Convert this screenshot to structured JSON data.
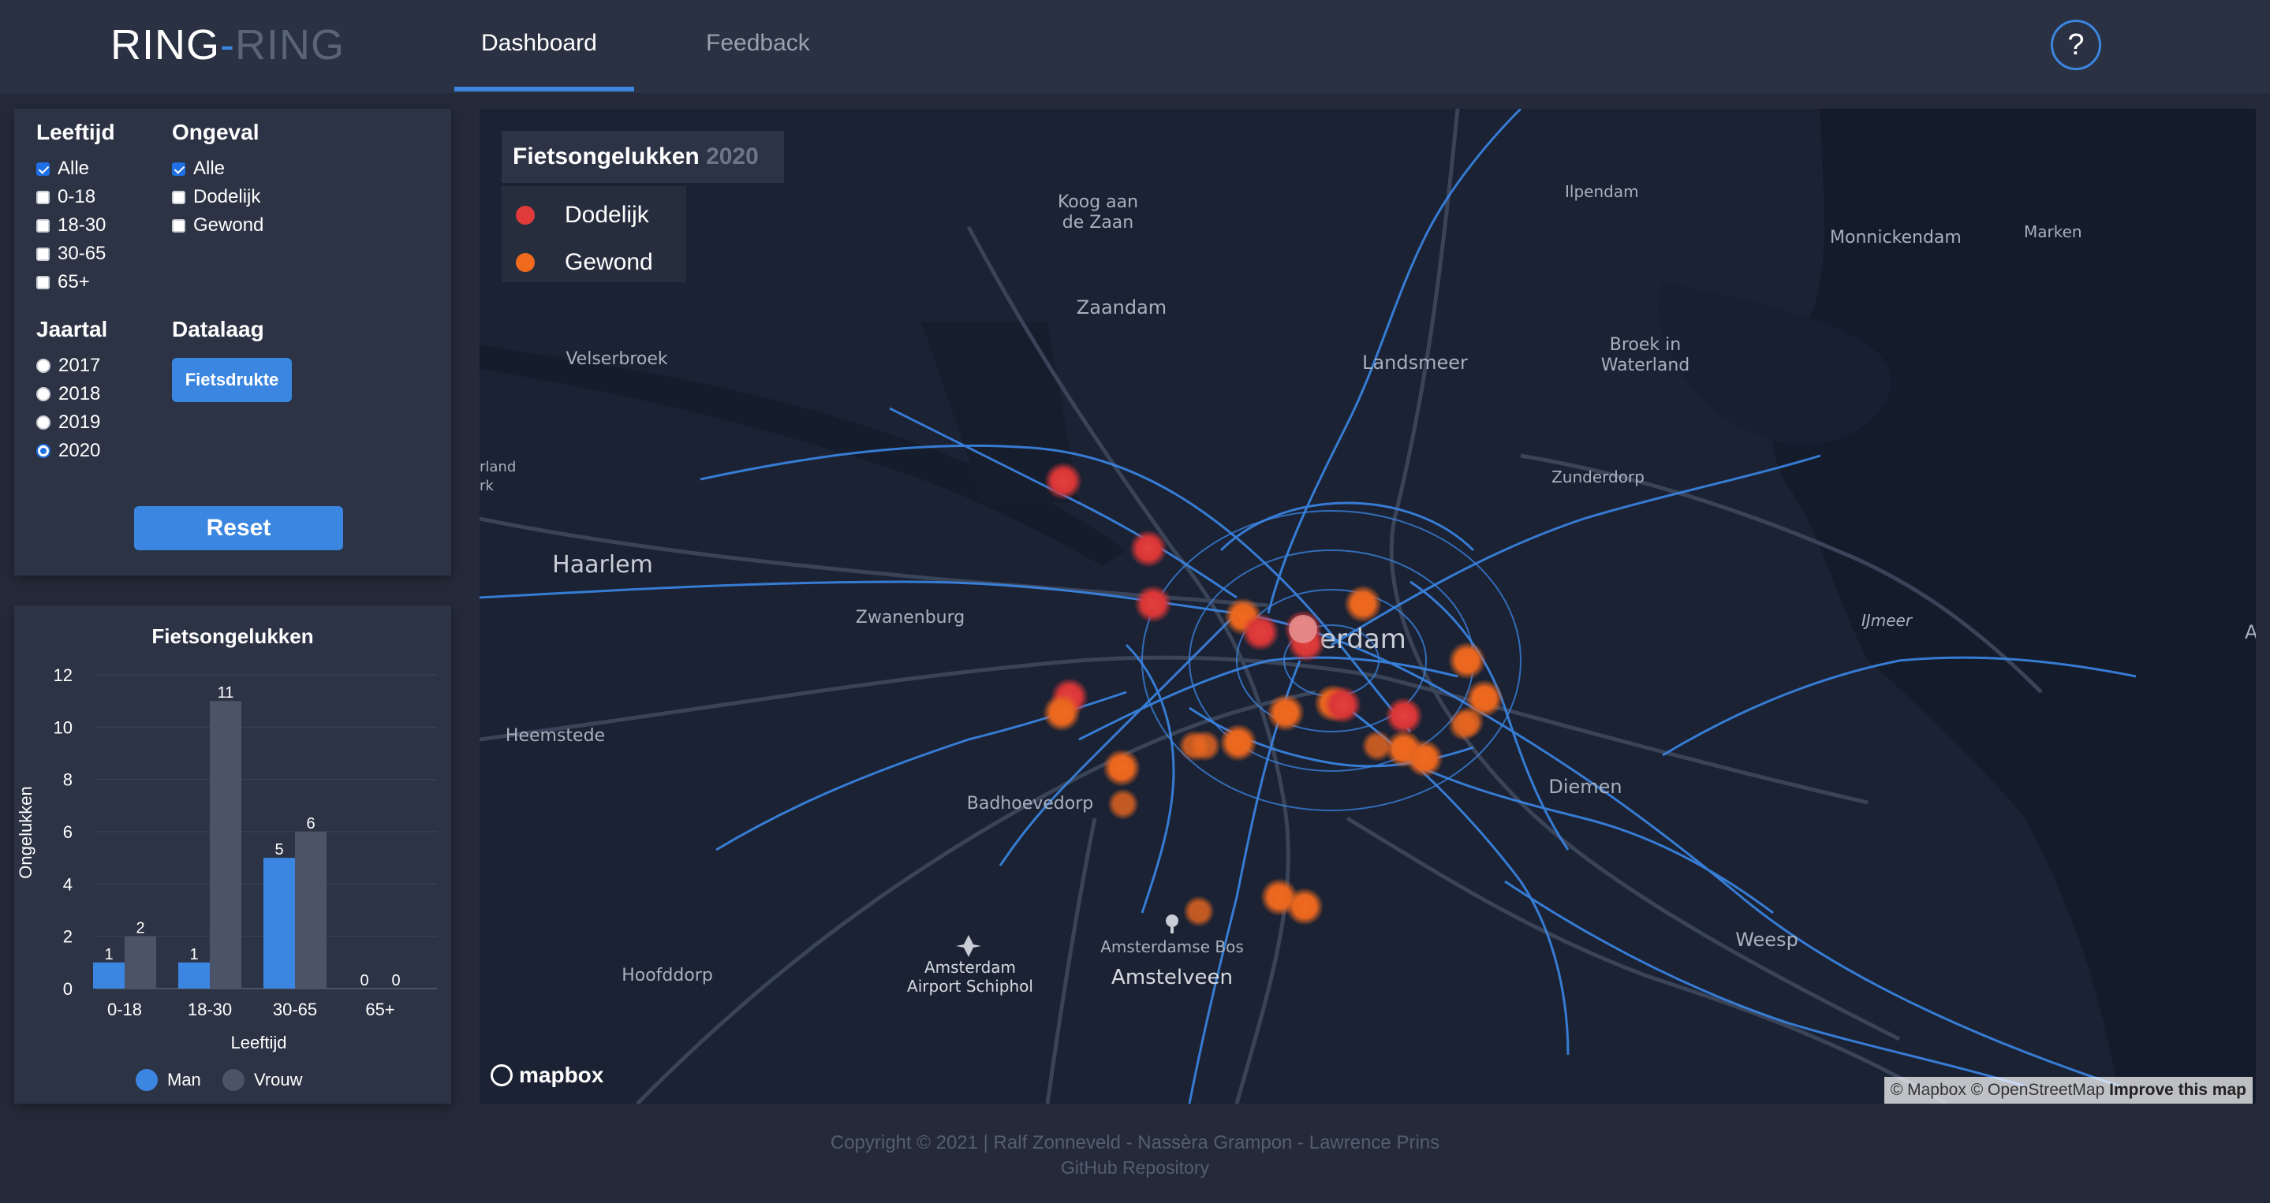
{
  "brand": {
    "part1": "RING",
    "dash": "-",
    "part2": "RING"
  },
  "nav": {
    "tabs": [
      {
        "label": "Dashboard"
      },
      {
        "label": "Feedback"
      }
    ],
    "help_label": "?"
  },
  "filters": {
    "leeftijd": {
      "label": "Leeftijd",
      "options": [
        {
          "label": "Alle",
          "checked": true
        },
        {
          "label": "0-18",
          "checked": false
        },
        {
          "label": "18-30",
          "checked": false
        },
        {
          "label": "30-65",
          "checked": false
        },
        {
          "label": "65+",
          "checked": false
        }
      ]
    },
    "ongeval": {
      "label": "Ongeval",
      "options": [
        {
          "label": "Alle",
          "checked": true
        },
        {
          "label": "Dodelijk",
          "checked": false
        },
        {
          "label": "Gewond",
          "checked": false
        }
      ]
    },
    "jaartal": {
      "label": "Jaartal",
      "options": [
        {
          "label": "2017",
          "checked": false
        },
        {
          "label": "2018",
          "checked": false
        },
        {
          "label": "2019",
          "checked": false
        },
        {
          "label": "2020",
          "checked": true
        }
      ]
    },
    "datalaag": {
      "label": "Datalaag",
      "button": "Fietsdrukte"
    },
    "reset": "Reset"
  },
  "chart_data": {
    "type": "bar",
    "title": "Fietsongelukken",
    "xlabel": "Leeftijd",
    "ylabel": "Ongelukken",
    "categories": [
      "0-18",
      "18-30",
      "30-65",
      "65+"
    ],
    "series": [
      {
        "name": "Man",
        "values": [
          1,
          1,
          5,
          0
        ],
        "color": "#3b86e0"
      },
      {
        "name": "Vrouw",
        "values": [
          2,
          11,
          6,
          0
        ],
        "color": "#4d5366"
      }
    ],
    "yticks": [
      "0",
      "2",
      "4",
      "6",
      "8",
      "10",
      "12"
    ],
    "ylim": [
      0,
      12
    ],
    "grid": true,
    "legend": "bottom"
  },
  "map": {
    "legend_title": "Fietsongelukken",
    "legend_year": "2020",
    "legend_items": [
      {
        "label": "Dodelijk",
        "color": "#e03a3a"
      },
      {
        "label": "Gewond",
        "color": "#f06a1e"
      }
    ],
    "places": [
      "Koog aan",
      "de Zaan",
      "Ilpendam",
      "Monnickendam",
      "Marken",
      "Zaandam",
      "Landsmeer",
      "Broek in",
      "Waterland",
      "Velserbroek",
      "rland",
      "rk",
      "Zunderdorp",
      "Haarlem",
      "Zwanenburg",
      "IJmeer",
      "A",
      "Heemstede",
      "Diemen",
      "Badhoevedorp",
      "Amsterdam",
      "Airport Schiphol",
      "Amsterdamse Bos",
      "Amstelveen",
      "Hoofddorp",
      "Weesp",
      "erdam"
    ],
    "accidents": [
      {
        "type": "Dodelijk"
      },
      {
        "type": "Dodelijk"
      },
      {
        "type": "Dodelijk"
      },
      {
        "type": "Gewond"
      },
      {
        "type": "Dodelijk"
      },
      {
        "type": "Dodelijk"
      },
      {
        "type": "Gewond"
      },
      {
        "type": "Dodelijk"
      },
      {
        "type": "Gewond"
      },
      {
        "type": "Gewond"
      },
      {
        "type": "Dodelijk"
      },
      {
        "type": "Gewond"
      },
      {
        "type": "Dodelijk"
      },
      {
        "type": "Gewond"
      },
      {
        "type": "Gewond"
      },
      {
        "type": "Dodelijk"
      },
      {
        "type": "Gewond"
      },
      {
        "type": "Gewond"
      },
      {
        "type": "Gewond"
      },
      {
        "type": "Gewond"
      },
      {
        "type": "Gewond"
      },
      {
        "type": "Gewond"
      }
    ],
    "mapbox_label": "mapbox",
    "attribution": {
      "mapbox": "© Mapbox",
      "osm": "© OpenStreetMap",
      "improve": "Improve this map"
    }
  },
  "footer": {
    "copyright": "Copyright © 2021 | Ralf Zonneveld - Nassèra Grampon - Lawrence Prins",
    "repo": "GitHub Repository"
  }
}
